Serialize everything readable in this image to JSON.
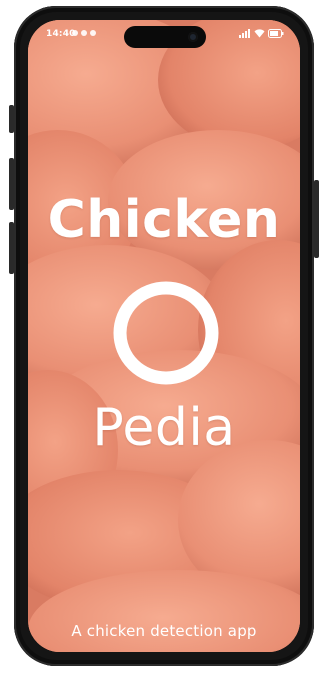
{
  "status_bar": {
    "time": "14:40",
    "left_icons": [
      "notification-icon",
      "notification-icon",
      "notification-icon"
    ],
    "right_icons": [
      "signal-icon",
      "wifi-icon",
      "battery-icon"
    ]
  },
  "splash": {
    "logo_line_1": "Chicken",
    "logo_line_2": "O",
    "logo_line_3": "Pedia",
    "tagline": "A chicken detection app"
  },
  "colors": {
    "background": "#e58a6f",
    "text": "#ffffff",
    "frame": "#151515"
  }
}
